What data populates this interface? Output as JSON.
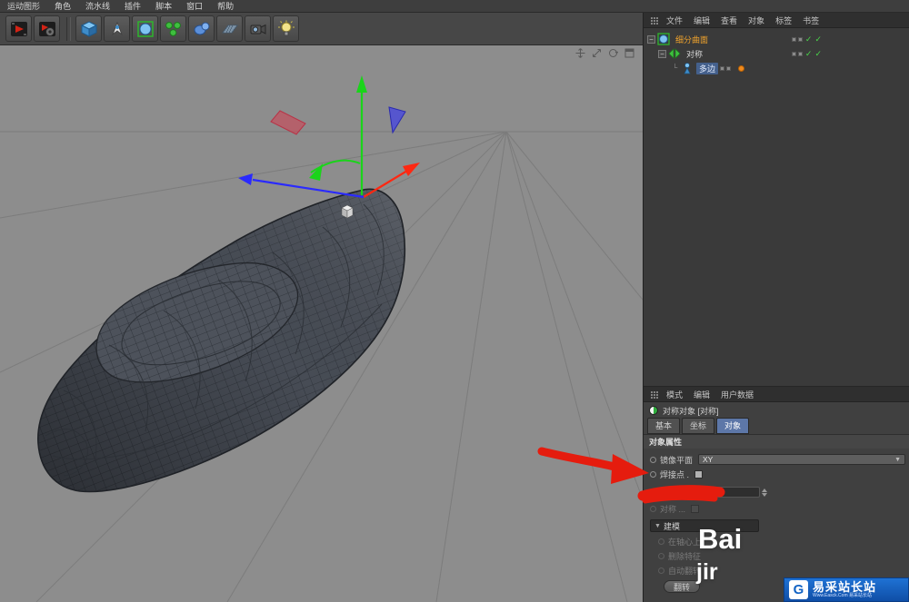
{
  "menubar": {
    "items": [
      "运动图形",
      "角色",
      "流水线",
      "插件",
      "脚本",
      "窗口",
      "帮助"
    ]
  },
  "object_manager": {
    "menu_items": [
      "文件",
      "编辑",
      "查看",
      "对象",
      "标签",
      "书签"
    ],
    "tree": [
      {
        "name": "细分曲面"
      },
      {
        "name": "对称"
      },
      {
        "name": "多边"
      }
    ]
  },
  "attributes": {
    "menu_items": [
      "模式",
      "编辑",
      "用户数据"
    ],
    "title": "对称对象 [对称]",
    "tabs": [
      "基本",
      "坐标",
      "对象"
    ],
    "active_tab": "对象",
    "section_object": "对象属性",
    "mirror_plane_label": "镜像平面",
    "mirror_plane_value": "XY",
    "weld_points_label": "焊接点 .",
    "symmetry_label": "对称 ...",
    "modeling_group": "建模",
    "modeling_items": [
      "在轴心上",
      "删除特征",
      "自动翻转"
    ],
    "flip_button": "翻转"
  },
  "watermark": {
    "line1": "Bai",
    "line2": "jir"
  },
  "footer_logo": {
    "title": "易采站长站",
    "subtitle": "Www.Easck.Com 易采站长站"
  },
  "colors": {
    "accent_orange": "#f0a32c",
    "selection_blue": "#44608c",
    "annotation_red": "#e51c0e",
    "viewport_gray": "#8d8d8d"
  }
}
